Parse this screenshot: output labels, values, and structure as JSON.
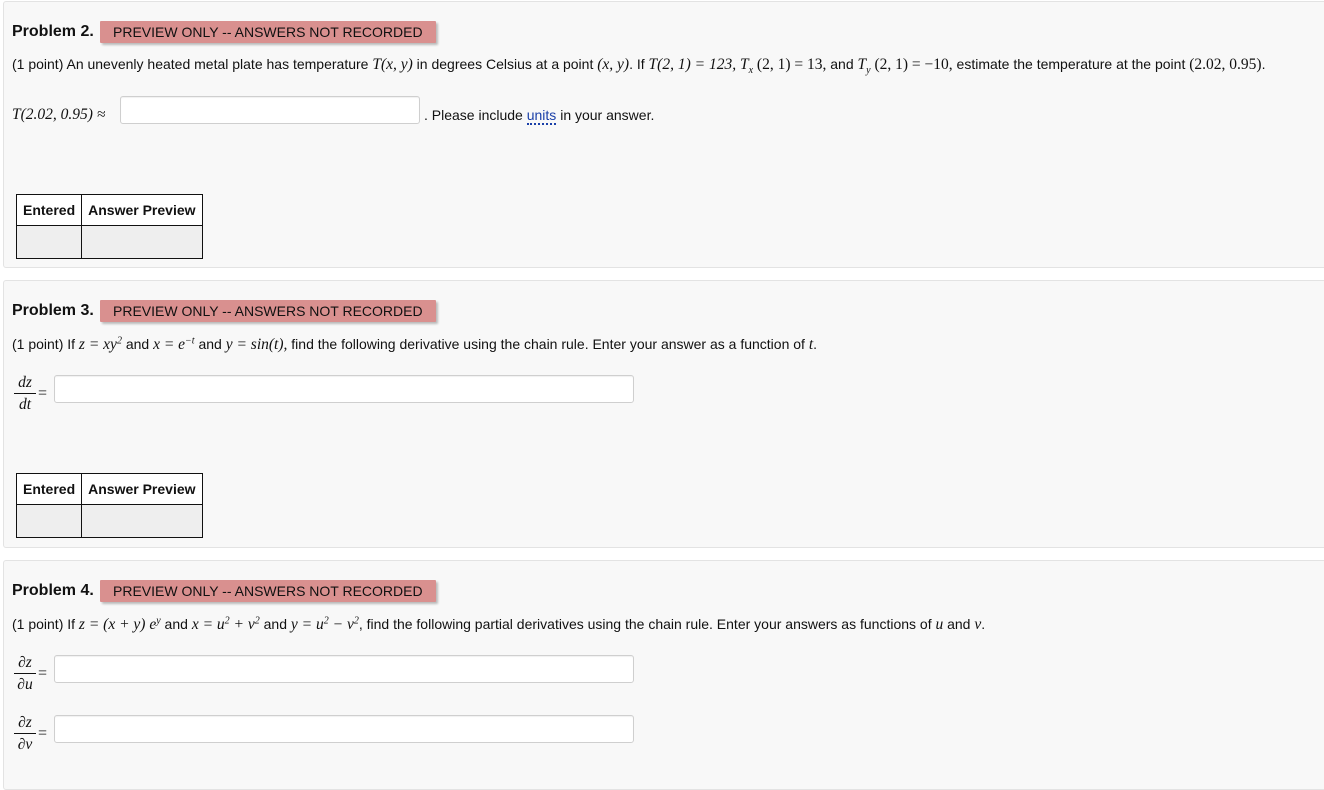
{
  "badge_text": "PREVIEW ONLY -- ANSWERS NOT RECORDED",
  "table_headers": [
    "Entered",
    "Answer Preview"
  ],
  "p2": {
    "title": "Problem 2.",
    "stmt": {
      "a": "(1 point) An unevenly heated metal plate has temperature ",
      "Txy": "T(x, y)",
      "b": " in degrees Celsius at a point ",
      "xy": "(x, y)",
      "c": ". If ",
      "T21": "T(2, 1) = 123,",
      "Tx": "T",
      "Tx_sub": "x",
      "Tx_rest": " (2, 1) = 13,",
      "d": " and ",
      "Ty": "T",
      "Ty_sub": "y",
      "Ty_rest": " (2, 1) = −10,",
      "e": " estimate the temperature at the point ",
      "pt": "(2.02, 0.95)",
      "f": "."
    },
    "answer_label": "T(2.02, 0.95) ≈",
    "answer_value": "",
    "after_a": ". Please include ",
    "units_link": "units",
    "after_b": " in your answer."
  },
  "p3": {
    "title": "Problem 3.",
    "stmt": {
      "a": "(1 point) If ",
      "z": "z = xy",
      "z_sup": "2",
      "b": " and ",
      "x": "x = e",
      "x_sup": "−t",
      "c": " and ",
      "y": "y = sin(t),",
      "d": " find the following derivative using the chain rule. Enter your answer as a function of ",
      "t": "t",
      "e": "."
    },
    "frac_num": "dz",
    "frac_den": "dt",
    "eq": "=",
    "answer_value": ""
  },
  "p4": {
    "title": "Problem 4.",
    "stmt": {
      "a": "(1 point) If ",
      "z": "z = (x + y) e",
      "z_sup": "y",
      "b": " and ",
      "x": "x = u",
      "x_sup": "2",
      "x_rest": " + v",
      "x_sup2": "2",
      "c": " and ",
      "y": "y = u",
      "y_sup": "2",
      "y_rest": " − v",
      "y_sup2": "2",
      "d": ", find the following partial derivatives using the chain rule. Enter your answers as functions of ",
      "u": "u",
      "e": " and ",
      "v": "v",
      "f": "."
    },
    "frac1_num": "∂z",
    "frac1_den": "∂u",
    "frac2_num": "∂z",
    "frac2_den": "∂v",
    "eq": "=",
    "answer1_value": "",
    "answer2_value": ""
  }
}
